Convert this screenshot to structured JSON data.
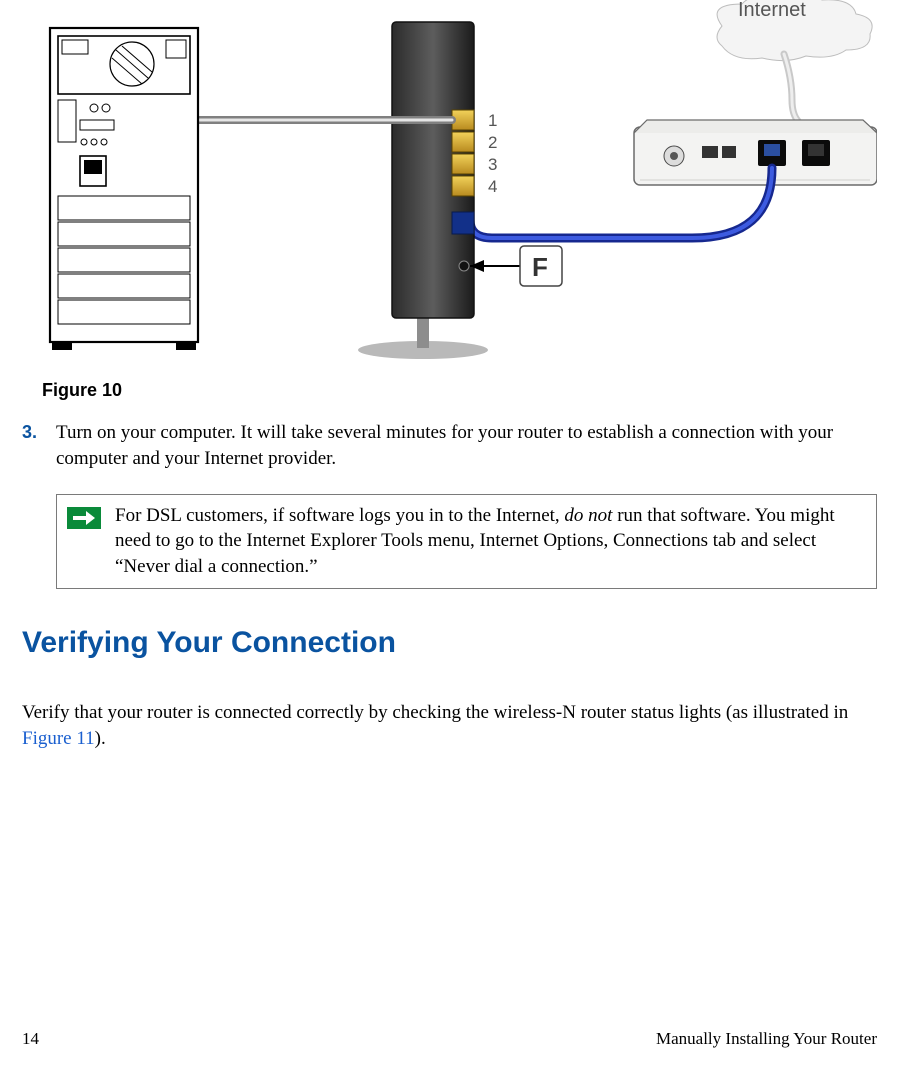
{
  "diagram": {
    "cloud_label": "Internet",
    "port_labels": [
      "1",
      "2",
      "3",
      "4"
    ],
    "callout_label": "F"
  },
  "figure_caption": "Figure 10",
  "step": {
    "number": "3.",
    "text": "Turn on your computer. It will take several minutes for your router to establish a connection with your computer and your Internet provider."
  },
  "note": {
    "prefix": "For DSL customers, if software logs you in to the Internet, ",
    "emphasis": "do not",
    "suffix": " run that software. You might need to go to the Internet Explorer Tools menu, Internet Options, Connections tab and select “Never dial a connection.”"
  },
  "heading": "Verifying Your Connection",
  "paragraph": {
    "prefix": "Verify that your router is connected correctly by checking the wireless-N router status lights (as illustrated in ",
    "link_text": "Figure 11",
    "suffix": ")."
  },
  "footer": {
    "page_number": "14",
    "section_title": "Manually Installing Your Router"
  }
}
